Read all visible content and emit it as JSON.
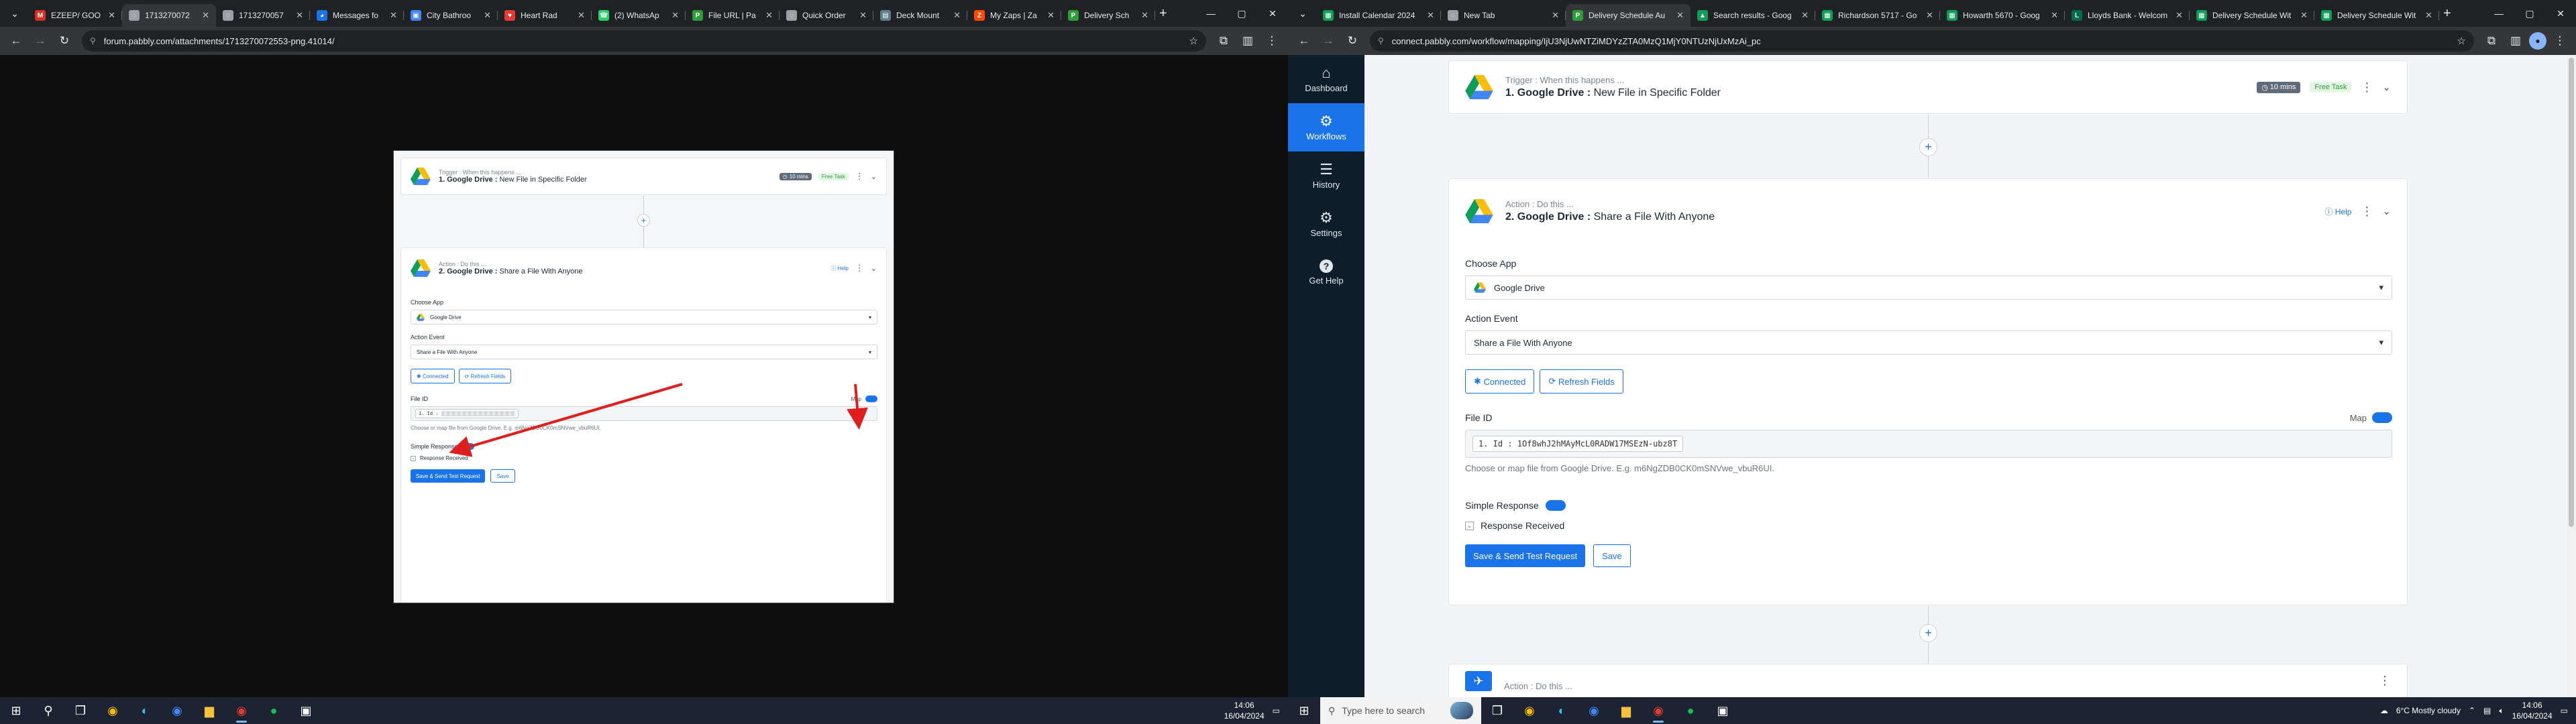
{
  "left_browser": {
    "tabs": [
      {
        "title": "EZEEP/ GOO",
        "favicon_color": "#d93025",
        "favicon_char": "M"
      },
      {
        "title": "1713270072",
        "favicon_color": "#9aa0a6",
        "favicon_char": "◌",
        "active": true
      },
      {
        "title": "1713270057",
        "favicon_color": "#9aa0a6",
        "favicon_char": "◌"
      },
      {
        "title": "Messages fo",
        "favicon_color": "#1a73e8",
        "favicon_char": "◕"
      },
      {
        "title": "City Bathroo",
        "favicon_color": "#4285f4",
        "favicon_char": "▣"
      },
      {
        "title": "Heart Rad",
        "favicon_color": "#e53935",
        "favicon_char": "♥"
      },
      {
        "title": "(2) WhatsAp",
        "favicon_color": "#25d366",
        "favicon_char": "☎"
      },
      {
        "title": "File URL | Pa",
        "favicon_color": "#2e9c39",
        "favicon_char": "P"
      },
      {
        "title": "Quick Order",
        "favicon_color": "#9aa0a6",
        "favicon_char": "◌"
      },
      {
        "title": "Deck Mount",
        "favicon_color": "#607d8b",
        "favicon_char": "▤"
      },
      {
        "title": "My Zaps | Za",
        "favicon_color": "#ff4a00",
        "favicon_char": "Z"
      },
      {
        "title": "Delivery Sch",
        "favicon_color": "#2e9c39",
        "favicon_char": "P"
      }
    ],
    "url": "forum.pabbly.com/attachments/1713270072553-png.41014/"
  },
  "right_browser": {
    "tabs": [
      {
        "title": "Install Calendar 2024",
        "favicon_color": "#0f9d58",
        "favicon_char": "▦"
      },
      {
        "title": "New Tab",
        "favicon_color": "#9aa0a6",
        "favicon_char": "◌"
      },
      {
        "title": "Delivery Schedule Au",
        "favicon_color": "#2e9c39",
        "favicon_char": "P",
        "active": true
      },
      {
        "title": "Search results - Goog",
        "favicon_color": "#0f9d58",
        "favicon_char": "▲"
      },
      {
        "title": "Richardson 5717 - Go",
        "favicon_color": "#0f9d58",
        "favicon_char": "▦"
      },
      {
        "title": "Howarth 5670 - Goog",
        "favicon_color": "#0f9d58",
        "favicon_char": "▦"
      },
      {
        "title": "Lloyds Bank - Welcom",
        "favicon_color": "#006a4d",
        "favicon_char": "L"
      },
      {
        "title": "Delivery Schedule Wit",
        "favicon_color": "#0f9d58",
        "favicon_char": "▦"
      },
      {
        "title": "Delivery Schedule Wit",
        "favicon_color": "#0f9d58",
        "favicon_char": "▦"
      }
    ],
    "url": "connect.pabbly.com/workflow/mapping/IjU3NjUwNTZiMDYzZTA0MzQ1MjY0NTUzNjUxMzAi_pc"
  },
  "sidebar": {
    "items": [
      {
        "label": "Dashboard",
        "icon": "home-icon"
      },
      {
        "label": "Workflows",
        "icon": "workflows-icon",
        "active": true
      },
      {
        "label": "History",
        "icon": "history-icon"
      },
      {
        "label": "Settings",
        "icon": "gear-icon"
      },
      {
        "label": "Get Help",
        "icon": "help-icon"
      }
    ]
  },
  "workflow": {
    "trigger": {
      "sub": "Trigger : When this happens ...",
      "app": "1. Google Drive :",
      "event": "New File in Specific Folder",
      "mins": "10 mins",
      "free": "Free Task"
    },
    "action": {
      "sub": "Action : Do this ...",
      "app": "2. Google Drive :",
      "event": "Share a File With Anyone",
      "help": "Help",
      "choose_app_label": "Choose App",
      "choose_app_value": "Google Drive",
      "action_event_label": "Action Event",
      "action_event_value": "Share a File With Anyone",
      "connected": "Connected",
      "refresh": "Refresh Fields",
      "file_id_label": "File ID",
      "map_label": "Map",
      "file_id_pill": "1. Id : 1Of8whJ2hMAyMcL0RADW17MSEzN-ubz8T",
      "file_id_pill_short": "1. Id :",
      "hint": "Choose or map file from Google Drive. E.g. m6NgZDB0CK0mSNVwe_vbuR6UI.",
      "simple_response": "Simple Response",
      "response_received": "Response Received",
      "send_test": "Save & Send Test Request",
      "save": "Save"
    },
    "next": {
      "sub": "Action : Do this ..."
    }
  },
  "taskbar_left": {
    "time": "14:06",
    "date": "16/04/2024"
  },
  "taskbar_right": {
    "search_placeholder": "Type here to search",
    "weather": "6°C  Mostly cloudy",
    "time": "14:06",
    "date": "16/04/2024"
  }
}
